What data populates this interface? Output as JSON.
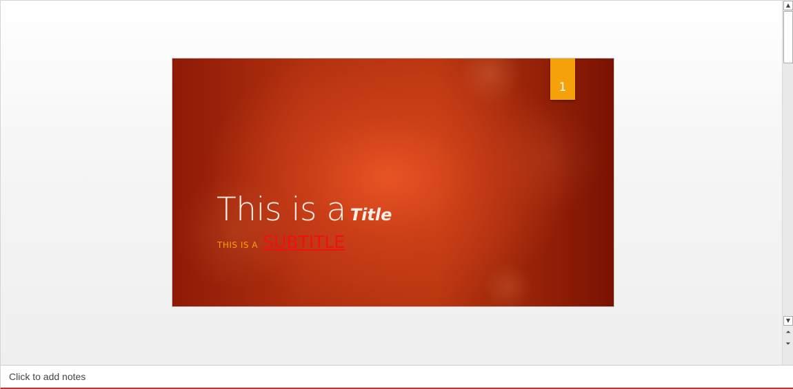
{
  "slide": {
    "number": "1",
    "title_main": "This is a",
    "title_emphasis": "Title",
    "subtitle_small": "THIS IS A",
    "subtitle_link": "SUBTITLE"
  },
  "scrollbar": {
    "up_icon": "▲",
    "down_icon": "▼",
    "prev_slide_icon": "⏶",
    "next_slide_icon": "⏷"
  },
  "notes": {
    "placeholder": "Click to add notes"
  },
  "colors": {
    "slide_accent": "#f5a20a",
    "subtitle_link": "#ee1111",
    "slide_background": "#b0300f"
  }
}
